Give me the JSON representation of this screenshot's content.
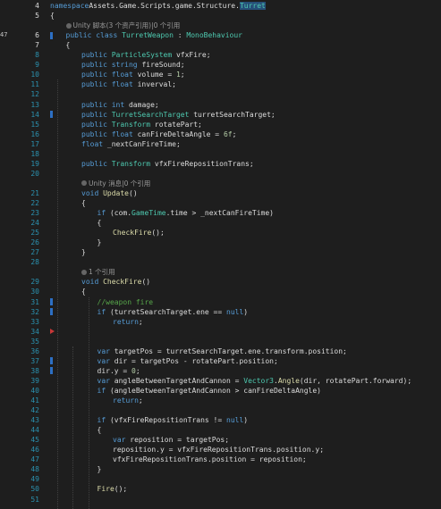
{
  "editor": {
    "extra_number": "47",
    "lines": [
      {
        "n": "4",
        "indent": 0,
        "tokens": [
          [
            "kw",
            "namespace"
          ],
          [
            "",
            "Assets.Game.Scripts.game.Structure."
          ],
          [
            "ty",
            "Turret"
          ]
        ]
      },
      {
        "n": "5",
        "indent": 0,
        "tokens": [
          [
            "",
            "{"
          ]
        ]
      },
      {
        "n": "",
        "indent": 1,
        "hint": "Unity 脚本(3 个资产引用)|0 个引用"
      },
      {
        "n": "6",
        "indent": 1,
        "tokens": [
          [
            "kw",
            "public class "
          ],
          [
            "ty",
            "TurretWeapon"
          ],
          [
            "",
            " : "
          ],
          [
            "ty",
            "MonoBehaviour"
          ]
        ]
      },
      {
        "n": "7",
        "indent": 1,
        "tokens": [
          [
            "",
            "{"
          ]
        ]
      },
      {
        "n": "8",
        "indent": 2,
        "tokens": [
          [
            "kw",
            "public "
          ],
          [
            "ty",
            "ParticleSystem"
          ],
          [
            "",
            " vfxFire;"
          ]
        ]
      },
      {
        "n": "9",
        "indent": 2,
        "tokens": [
          [
            "kw",
            "public string"
          ],
          [
            "",
            " fireSound;"
          ]
        ]
      },
      {
        "n": "10",
        "indent": 2,
        "tokens": [
          [
            "kw",
            "public float"
          ],
          [
            "",
            " volume = "
          ],
          [
            "nm",
            "1"
          ],
          [
            "",
            ";"
          ]
        ]
      },
      {
        "n": "11",
        "indent": 2,
        "tokens": [
          [
            "kw",
            "public float"
          ],
          [
            "",
            " inverval;"
          ]
        ]
      },
      {
        "n": "12",
        "indent": 2,
        "tokens": []
      },
      {
        "n": "13",
        "indent": 2,
        "tokens": [
          [
            "kw",
            "public int"
          ],
          [
            "",
            " damage;"
          ]
        ]
      },
      {
        "n": "14",
        "indent": 2,
        "tokens": [
          [
            "kw",
            "public "
          ],
          [
            "ty",
            "TurretSearchTarget"
          ],
          [
            "",
            " turretSearchTarget;"
          ]
        ]
      },
      {
        "n": "15",
        "indent": 2,
        "tokens": [
          [
            "kw",
            "public "
          ],
          [
            "ty",
            "Transform"
          ],
          [
            "",
            " rotatePart;"
          ]
        ]
      },
      {
        "n": "16",
        "indent": 2,
        "tokens": [
          [
            "kw",
            "public float"
          ],
          [
            "",
            " canFireDeltaAngle = "
          ],
          [
            "nm",
            "6f"
          ],
          [
            "",
            ";"
          ]
        ]
      },
      {
        "n": "17",
        "indent": 2,
        "tokens": [
          [
            "kw",
            "float"
          ],
          [
            "",
            " _nextCanFireTime;"
          ]
        ]
      },
      {
        "n": "18",
        "indent": 2,
        "tokens": []
      },
      {
        "n": "19",
        "indent": 2,
        "tokens": [
          [
            "kw",
            "public "
          ],
          [
            "ty",
            "Transform"
          ],
          [
            "",
            " vfxFireRepositionTrans;"
          ]
        ]
      },
      {
        "n": "20",
        "indent": 2,
        "tokens": []
      },
      {
        "n": "",
        "indent": 2,
        "hint": "Unity 消息|0 个引用"
      },
      {
        "n": "21",
        "indent": 2,
        "tokens": [
          [
            "kw",
            "void "
          ],
          [
            "fn",
            "Update"
          ],
          [
            "",
            "()"
          ]
        ]
      },
      {
        "n": "22",
        "indent": 2,
        "tokens": [
          [
            "",
            "{"
          ]
        ]
      },
      {
        "n": "23",
        "indent": 3,
        "tokens": [
          [
            "kw",
            "if"
          ],
          [
            "",
            " (com."
          ],
          [
            "ty",
            "GameTime"
          ],
          [
            "",
            ".time > _nextCanFireTime)"
          ]
        ]
      },
      {
        "n": "24",
        "indent": 3,
        "tokens": [
          [
            "",
            "{"
          ]
        ]
      },
      {
        "n": "25",
        "indent": 4,
        "tokens": [
          [
            "fn",
            "CheckFire"
          ],
          [
            "",
            "();"
          ]
        ]
      },
      {
        "n": "26",
        "indent": 3,
        "tokens": [
          [
            "",
            "}"
          ]
        ]
      },
      {
        "n": "27",
        "indent": 2,
        "tokens": [
          [
            "",
            "}"
          ]
        ]
      },
      {
        "n": "28",
        "indent": 2,
        "tokens": []
      },
      {
        "n": "",
        "indent": 2,
        "hint": "1 个引用"
      },
      {
        "n": "29",
        "indent": 2,
        "tokens": [
          [
            "kw",
            "void "
          ],
          [
            "fn",
            "CheckFire"
          ],
          [
            "",
            "()"
          ]
        ]
      },
      {
        "n": "30",
        "indent": 2,
        "tokens": [
          [
            "",
            "{"
          ]
        ]
      },
      {
        "n": "31",
        "indent": 3,
        "tokens": [
          [
            "cm",
            "//weapon fire"
          ]
        ]
      },
      {
        "n": "32",
        "indent": 3,
        "tokens": [
          [
            "kw",
            "if"
          ],
          [
            "",
            " (turretSearchTarget.ene == "
          ],
          [
            "kw",
            "null"
          ],
          [
            "",
            ")"
          ]
        ]
      },
      {
        "n": "33",
        "indent": 4,
        "tokens": [
          [
            "kw",
            "return"
          ],
          [
            "",
            ";"
          ]
        ]
      },
      {
        "n": "34",
        "indent": 3,
        "tokens": []
      },
      {
        "n": "35",
        "indent": 3,
        "tokens": []
      },
      {
        "n": "36",
        "indent": 3,
        "tokens": [
          [
            "kw",
            "var"
          ],
          [
            "",
            " targetPos = turretSearchTarget.ene.transform.position;"
          ]
        ]
      },
      {
        "n": "37",
        "indent": 3,
        "tokens": [
          [
            "kw",
            "var"
          ],
          [
            "",
            " dir = targetPos - rotatePart.position;"
          ]
        ]
      },
      {
        "n": "38",
        "indent": 3,
        "tokens": [
          [
            "",
            "dir.y = "
          ],
          [
            "nm",
            "0"
          ],
          [
            "",
            ";"
          ]
        ]
      },
      {
        "n": "39",
        "indent": 3,
        "tokens": [
          [
            "kw",
            "var"
          ],
          [
            "",
            " angleBetweenTargetAndCannon = "
          ],
          [
            "ty",
            "Vector3"
          ],
          [
            "",
            "."
          ],
          [
            "fn",
            "Angle"
          ],
          [
            "",
            "(dir, rotatePart.forward);"
          ]
        ]
      },
      {
        "n": "40",
        "indent": 3,
        "tokens": [
          [
            "kw",
            "if"
          ],
          [
            "",
            " (angleBetweenTargetAndCannon > canFireDeltaAngle)"
          ]
        ]
      },
      {
        "n": "41",
        "indent": 4,
        "tokens": [
          [
            "kw",
            "return"
          ],
          [
            "",
            ";"
          ]
        ]
      },
      {
        "n": "42",
        "indent": 3,
        "tokens": []
      },
      {
        "n": "43",
        "indent": 3,
        "tokens": [
          [
            "kw",
            "if"
          ],
          [
            "",
            " (vfxFireRepositionTrans != "
          ],
          [
            "kw",
            "null"
          ],
          [
            "",
            ")"
          ]
        ]
      },
      {
        "n": "44",
        "indent": 3,
        "tokens": [
          [
            "",
            "{"
          ]
        ]
      },
      {
        "n": "45",
        "indent": 4,
        "tokens": [
          [
            "kw",
            "var"
          ],
          [
            "",
            " reposition = targetPos;"
          ]
        ]
      },
      {
        "n": "46",
        "indent": 4,
        "tokens": [
          [
            "",
            "reposition.y = vfxFireRepositionTrans.position.y;"
          ]
        ]
      },
      {
        "n": "47",
        "indent": 4,
        "tokens": [
          [
            "",
            "vfxFireRepositionTrans.position = reposition;"
          ]
        ]
      },
      {
        "n": "48",
        "indent": 3,
        "tokens": [
          [
            "",
            "}"
          ]
        ]
      },
      {
        "n": "49",
        "indent": 3,
        "tokens": []
      },
      {
        "n": "50",
        "indent": 3,
        "tokens": [
          [
            "fn",
            "Fire"
          ],
          [
            "",
            "();"
          ]
        ]
      },
      {
        "n": "51",
        "indent": 3,
        "tokens": []
      }
    ]
  }
}
